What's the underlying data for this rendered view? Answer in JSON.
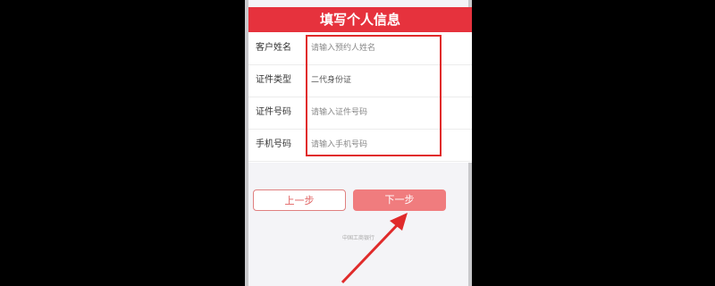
{
  "header": {
    "title": "填写个人信息"
  },
  "form": {
    "rows": [
      {
        "label": "客户姓名",
        "placeholder": "请输入预约人姓名"
      },
      {
        "label": "证件类型",
        "value": "二代身份证"
      },
      {
        "label": "证件号码",
        "placeholder": "请输入证件号码"
      },
      {
        "label": "手机号码",
        "placeholder": "请输入手机号码"
      }
    ]
  },
  "buttons": {
    "prev": "上一步",
    "next": "下一步"
  },
  "footer": {
    "text": "中国工商银行"
  },
  "colors": {
    "header": "#e6323d",
    "highlight": "#e02b2b",
    "next_button": "#f07c7e"
  }
}
